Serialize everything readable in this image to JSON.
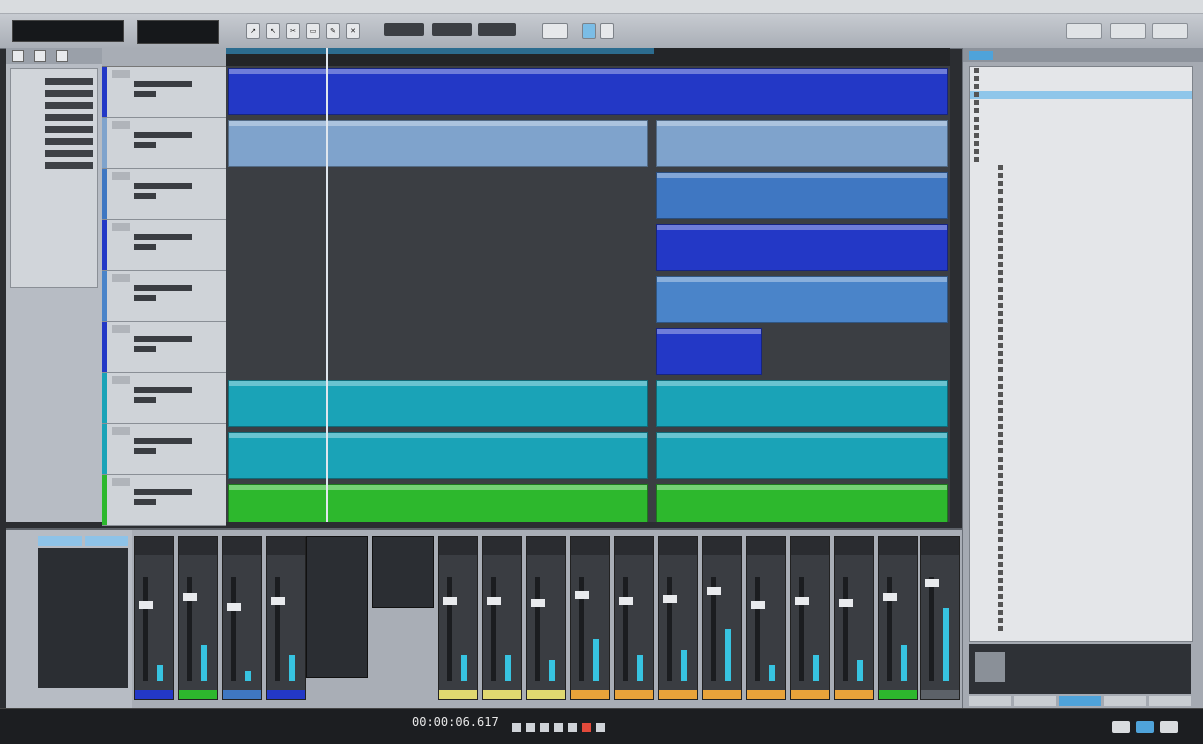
{
  "colors": {
    "track_blue_dark": "#2338c6",
    "track_blue_light": "#7fa3cc",
    "track_blue_mid": "#3f77c2",
    "track_teal": "#1aa3b7",
    "track_green": "#2db82d",
    "empty_lane": "#3b3e43",
    "selection": "#8fc6ea"
  },
  "icons": [
    "arrow-tool-icon",
    "range-tool-icon",
    "split-tool-icon",
    "eraser-tool-icon",
    "pencil-tool-icon",
    "mute-tool-icon",
    "play-icon",
    "stop-icon",
    "record-icon",
    "rewind-icon",
    "forward-icon",
    "loop-icon",
    "metronome-icon",
    "folder-icon",
    "audio-file-icon"
  ],
  "transport": {
    "time": "00:00:06.617"
  }
}
